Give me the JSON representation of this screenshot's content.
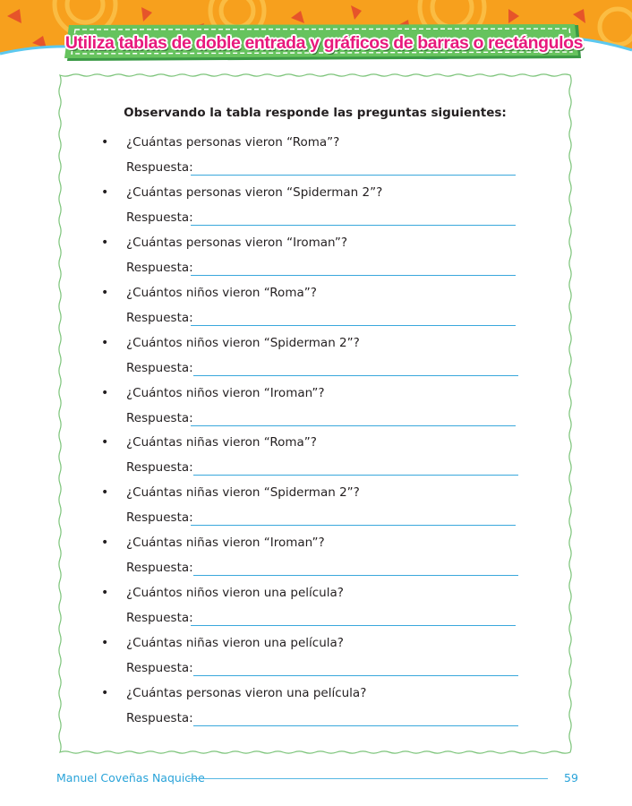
{
  "header": {
    "title": "Utiliza tablas de doble entrada y gráficos de barras o rectángulos",
    "colors": {
      "band": "#f7a01d",
      "banner_fill": "#5fbf5f",
      "title_text": "#e8197d"
    }
  },
  "worksheet": {
    "instruction": "Observando la tabla responde las preguntas siguientes:",
    "bullet": "•",
    "items": [
      {
        "question": "¿Cuántas personas vieron “Roma”?",
        "answer_label": "Respuesta:"
      },
      {
        "question": "¿Cuántas personas vieron “Spiderman 2”?",
        "answer_label": "Respuesta:"
      },
      {
        "question": "¿Cuántas personas vieron “Iroman”?",
        "answer_label": "Respuesta:"
      },
      {
        "question": "¿Cuántos niños vieron “Roma”?",
        "answer_label": "Respuesta:"
      },
      {
        "question": "¿Cuántos niños vieron “Spiderman 2”?",
        "answer_label": "Respuesta:"
      },
      {
        "question": "¿Cuántos niños vieron “Iroman”?",
        "answer_label": "Respuesta:"
      },
      {
        "question": "¿Cuántas niñas vieron “Roma”?",
        "answer_label": "Respuesta:"
      },
      {
        "question": "¿Cuántas niñas vieron “Spiderman 2”?",
        "answer_label": "Respuesta:"
      },
      {
        "question": "¿Cuántas niñas vieron “Iroman”?",
        "answer_label": "Respuesta:"
      },
      {
        "question": "¿Cuántos niños vieron una película?",
        "answer_label": "Respuesta:"
      },
      {
        "question": "¿Cuántas niñas vieron una película?",
        "answer_label": "Respuesta:"
      },
      {
        "question": "¿Cuántas personas vieron una película?",
        "answer_label": "Respuesta:"
      }
    ]
  },
  "footer": {
    "author": "Manuel Coveñas Naquiche",
    "page_number": "59",
    "color": "#29a3d9"
  }
}
